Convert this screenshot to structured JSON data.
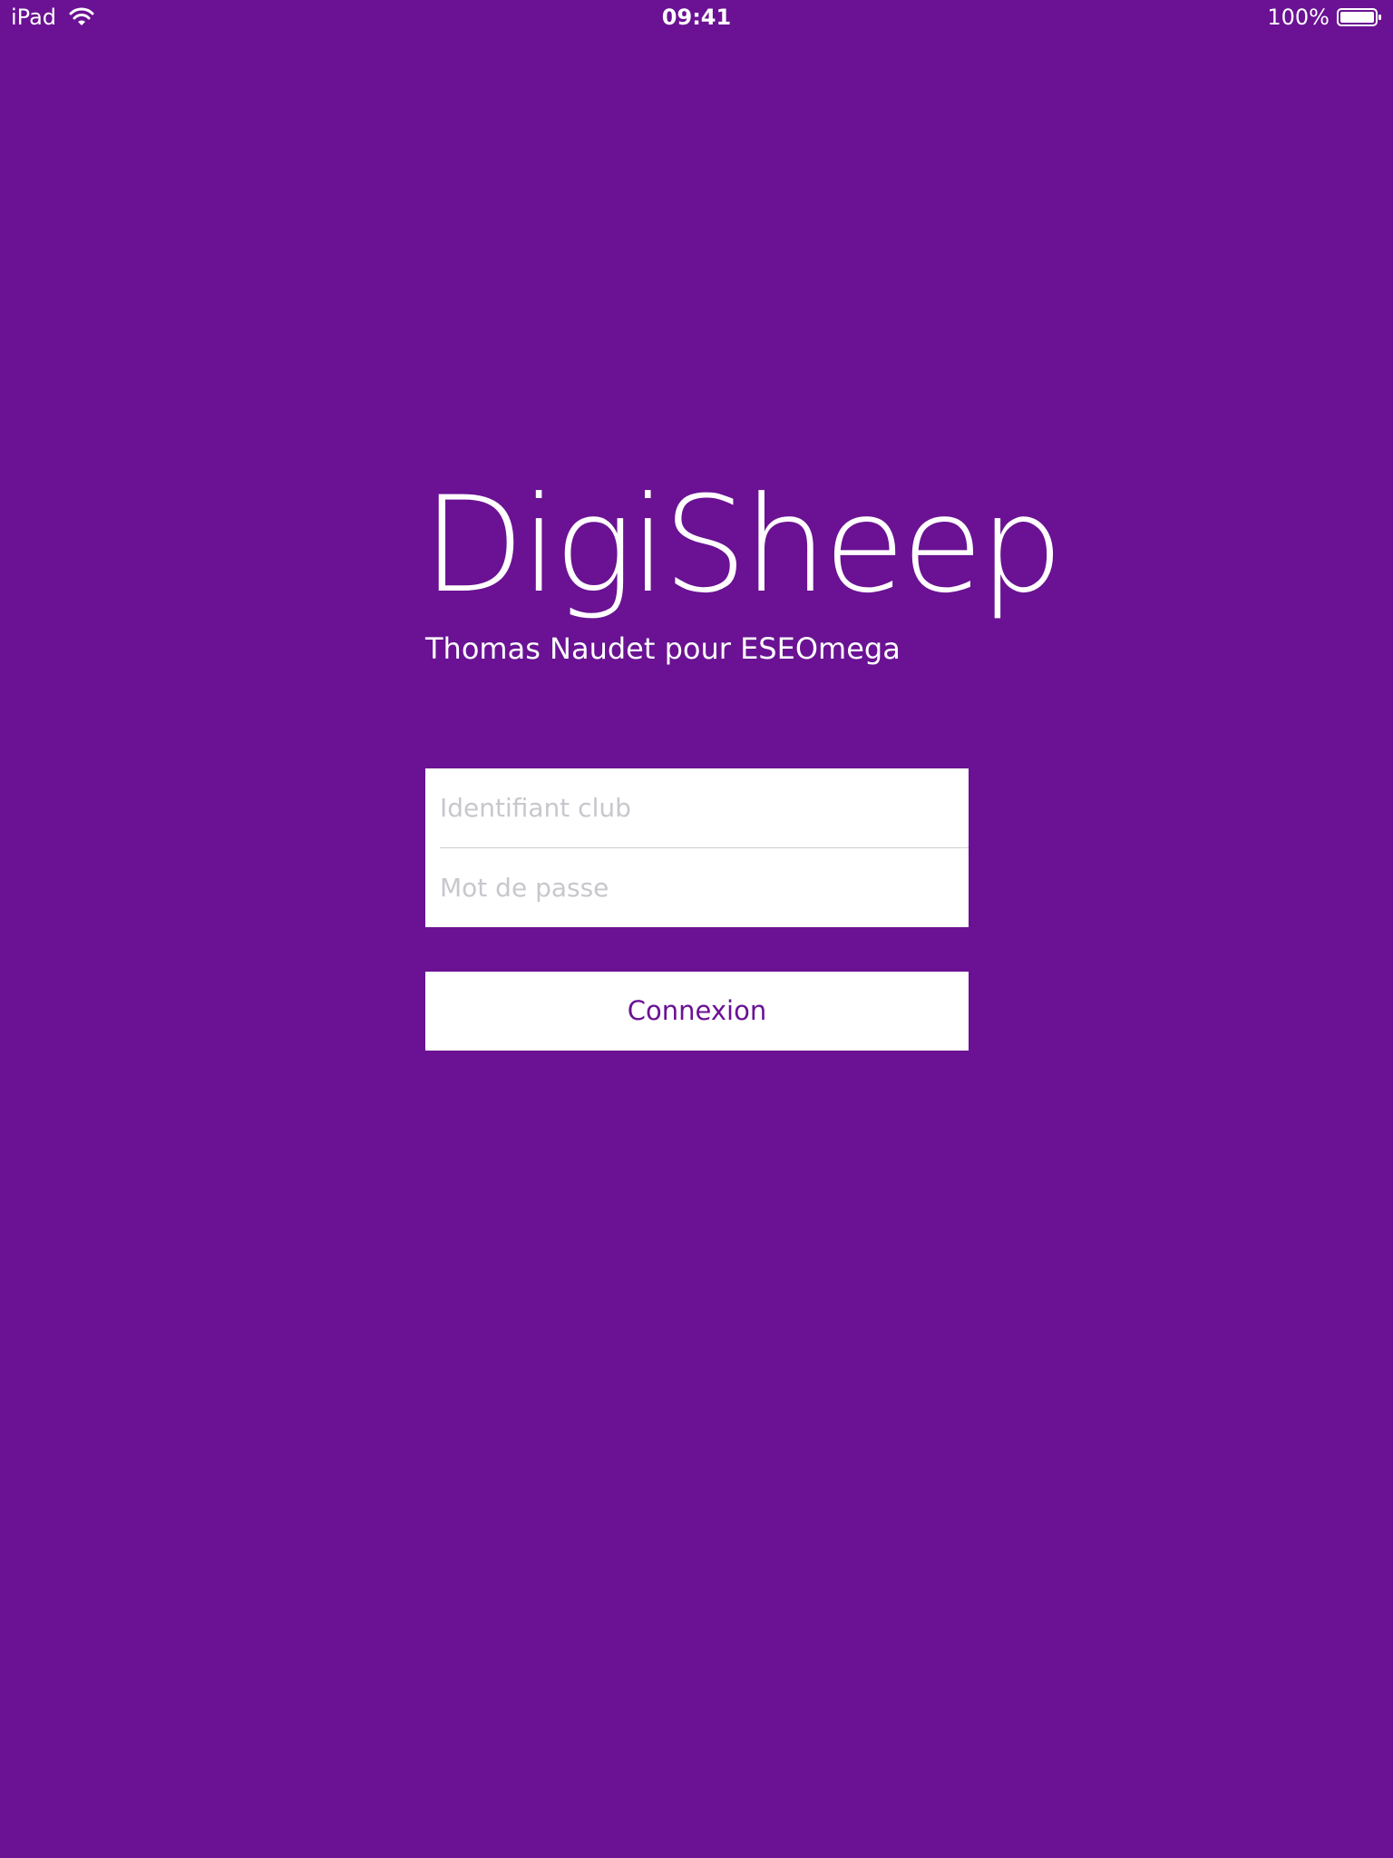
{
  "status_bar": {
    "device": "iPad",
    "time": "09:41",
    "battery": "100%",
    "icons": [
      "wifi-icon",
      "battery-icon"
    ]
  },
  "brand": {
    "title": "DigiSheep",
    "subtitle": "Thomas Naudet pour ESEOmega"
  },
  "form": {
    "club_id": {
      "value": "",
      "placeholder": "Identifiant club"
    },
    "password": {
      "value": "",
      "placeholder": "Mot de passe"
    },
    "submit_label": "Connexion"
  },
  "colors": {
    "background": "#6a1293",
    "surface": "#ffffff",
    "accent": "#6a1293",
    "placeholder": "#c7c7cd"
  }
}
